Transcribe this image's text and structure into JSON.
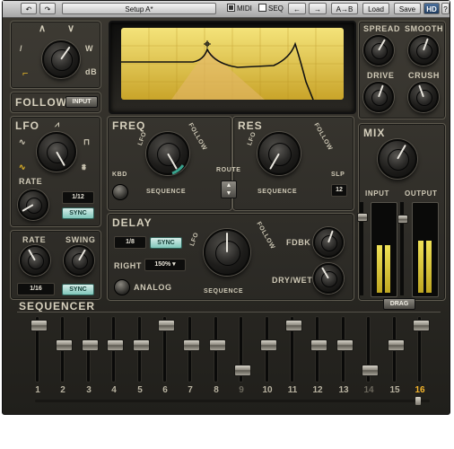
{
  "toolbar": {
    "undo_icon": "undo-arrow-icon",
    "redo_icon": "redo-arrow-icon",
    "preset_name": "Setup A*",
    "midi_label": "MIDI",
    "midi_checked": true,
    "seq_label": "SEQ",
    "seq_checked": false,
    "ab_label": "A→B",
    "load_label": "Load",
    "save_label": "Save",
    "hd_label": "HD",
    "help_label": "?"
  },
  "filter": {
    "waveform_labels": [
      "/",
      "W",
      "dB"
    ],
    "follow_label": "FOLLOW",
    "input_button": "INPUT",
    "display_color": "#e8d24a"
  },
  "lfo": {
    "title": "LFO",
    "rate_label": "RATE",
    "rate_value": "1/12",
    "sync_label": "SYNC",
    "shape_icons": [
      "sine-wave-icon",
      "saw-icon",
      "square-icon",
      "random-icon",
      "triangle-icon"
    ]
  },
  "rate_swing": {
    "rate_label": "RATE",
    "swing_label": "SWING",
    "rate_value": "1/16",
    "sync_label": "SYNC"
  },
  "freq": {
    "title": "FREQ",
    "lfo_label": "LFO",
    "follow_label": "FOLLOW",
    "sequence_label": "SEQUENCE",
    "kbd_label": "KBD"
  },
  "res": {
    "title": "RES",
    "lfo_label": "LFO",
    "follow_label": "FOLLOW",
    "sequence_label": "SEQUENCE",
    "slp_label": "SLP",
    "slp_value": "12"
  },
  "route": {
    "label": "ROUTE"
  },
  "right": {
    "spread_label": "SPREAD",
    "smooth_label": "SMOOTH",
    "drive_label": "DRIVE",
    "crush_label": "CRUSH",
    "mix_label": "MIX",
    "input_label": "INPUT",
    "output_label": "OUTPUT",
    "input_level": 0.55,
    "output_level": 0.6
  },
  "delay": {
    "title": "DELAY",
    "time_value": "1/8",
    "sync_label": "SYNC",
    "right_label": "RIGHT",
    "right_value": "150%",
    "analog_label": "ANALOG",
    "lfo_label": "LFO",
    "follow_label": "FOLLOW",
    "sequence_label": "SEQUENCE",
    "fdbk_label": "FDBK",
    "drywet_label": "DRY/WET"
  },
  "sequencer": {
    "title": "SEQUENCER",
    "drag_label": "DRAG",
    "steps": [
      {
        "label": "1",
        "value": 0.95
      },
      {
        "label": "2",
        "value": 0.6
      },
      {
        "label": "3",
        "value": 0.6
      },
      {
        "label": "4",
        "value": 0.6
      },
      {
        "label": "5",
        "value": 0.6
      },
      {
        "label": "6",
        "value": 0.95
      },
      {
        "label": "7",
        "value": 0.6
      },
      {
        "label": "8",
        "value": 0.6
      },
      {
        "label": "9",
        "value": 0.15
      },
      {
        "label": "10",
        "value": 0.6
      },
      {
        "label": "11",
        "value": 0.95
      },
      {
        "label": "12",
        "value": 0.6
      },
      {
        "label": "13",
        "value": 0.6
      },
      {
        "label": "14",
        "value": 0.15
      },
      {
        "label": "15",
        "value": 0.6
      },
      {
        "label": "16",
        "value": 0.95
      }
    ],
    "active_step": "16"
  }
}
